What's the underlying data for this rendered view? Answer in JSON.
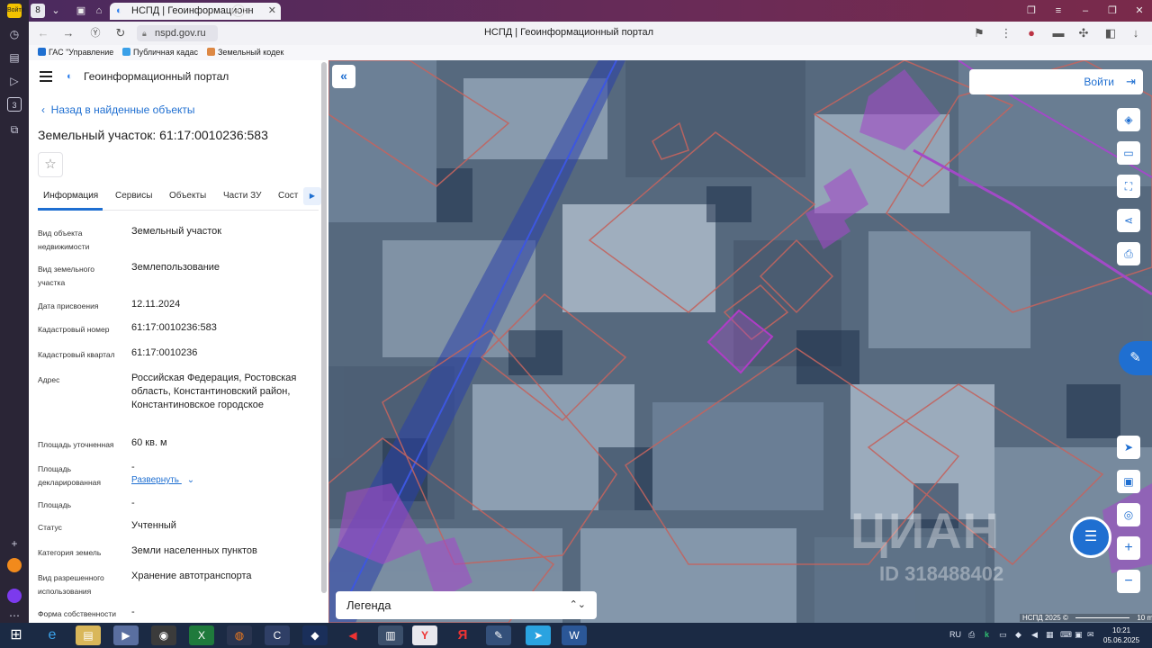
{
  "browser": {
    "tab_title": "НСПД | Геоинформационн",
    "tab_count": "8",
    "url": "nspd.gov.ru",
    "page_title": "НСПД | Геоинформационный портал",
    "login_badge": "Войти",
    "bookmarks": [
      "ГАС \"Управление",
      "Публичная кадас",
      "Земельный кодек"
    ]
  },
  "panel": {
    "portal_name": "Геоинформационный портал",
    "back_link": "Назад в найденные объекты",
    "object_title": "Земельный участок: 61:17:0010236:583",
    "tabs": [
      "Информация",
      "Сервисы",
      "Объекты",
      "Части ЗУ",
      "Сост"
    ],
    "expand_link": "Развернуть",
    "fields": [
      {
        "label": "Вид объекта недвижимости",
        "value": "Земельный участок"
      },
      {
        "label": "Вид земельного участка",
        "value": "Землепользование"
      },
      {
        "label": "Дата присвоения",
        "value": "12.11.2024"
      },
      {
        "label": "Кадастровый номер",
        "value": "61:17:0010236:583"
      },
      {
        "label": "Кадастровый квартал",
        "value": "61:17:0010236"
      },
      {
        "label": "Адрес",
        "value": "Российская Федерация, Ростовская область, Константиновский район, Константиновское городское"
      },
      {
        "label": "Площадь уточненная",
        "value": "60 кв. м"
      },
      {
        "label": "Площадь декларированная",
        "value": "-"
      },
      {
        "label": "Площадь",
        "value": "-"
      },
      {
        "label": "Статус",
        "value": "Учтенный"
      },
      {
        "label": "Категория земель",
        "value": "Земли населенных пунктов"
      },
      {
        "label": "Вид разрешенного использования",
        "value": "Хранение автотранспорта"
      },
      {
        "label": "Форма собственности",
        "value": "-"
      }
    ]
  },
  "map": {
    "login_label": "Войти",
    "legend_label": "Легенда",
    "watermark_text": "ЦИАН",
    "watermark_id": "ID 318488402",
    "attribution": "НСПД 2025 ©",
    "scale_label": "10 m"
  },
  "taskbar": {
    "lang": "RU",
    "time": "10:21",
    "date": "05.06.2025"
  },
  "colors": {
    "accent": "#1f6fd1",
    "parcel_outline": "#c2645f",
    "selected_parcel": "#b03cc7",
    "tabbar_gradient_start": "#4b2a5e"
  }
}
